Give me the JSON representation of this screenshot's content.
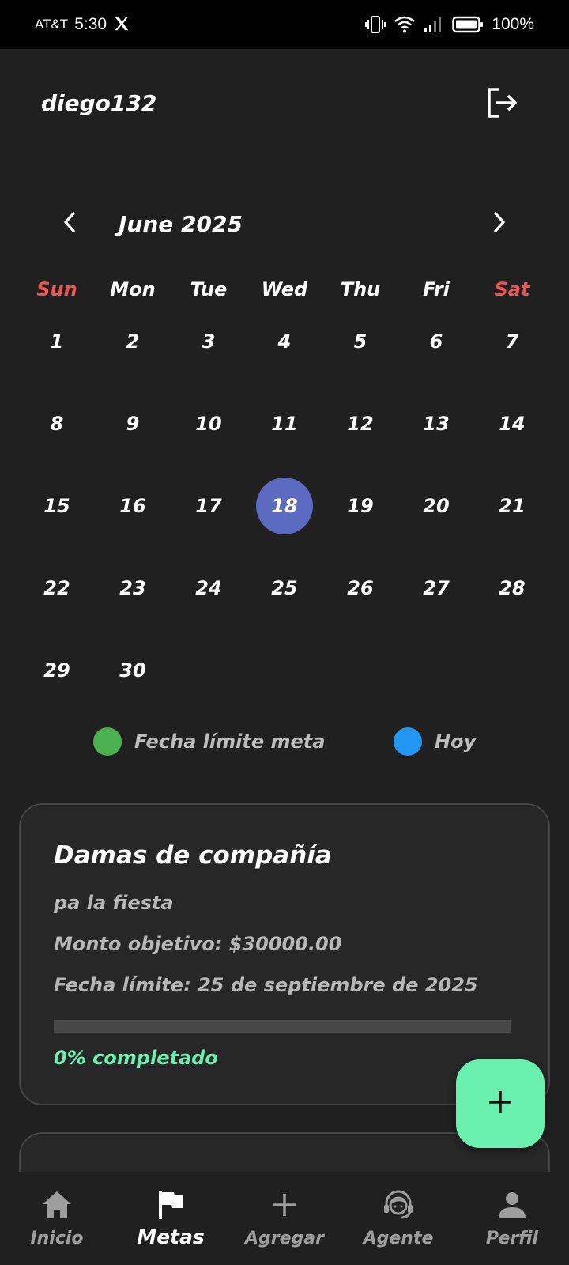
{
  "status_bar": {
    "carrier": "AT&T",
    "time": "5:30",
    "battery": "100%"
  },
  "header": {
    "username": "diego132",
    "logout_icon": "logout-icon"
  },
  "calendar": {
    "month_label": "June 2025",
    "weekdays": [
      "Sun",
      "Mon",
      "Tue",
      "Wed",
      "Thu",
      "Fri",
      "Sat"
    ],
    "days": [
      "1",
      "2",
      "3",
      "4",
      "5",
      "6",
      "7",
      "8",
      "9",
      "10",
      "11",
      "12",
      "13",
      "14",
      "15",
      "16",
      "17",
      "18",
      "19",
      "20",
      "21",
      "22",
      "23",
      "24",
      "25",
      "26",
      "27",
      "28",
      "29",
      "30"
    ],
    "selected_day": "18",
    "selected_color": "#5c6bc0",
    "weekend_color": "#ef5350"
  },
  "legend": {
    "meta_label": "Fecha límite meta",
    "meta_color": "#4caf50",
    "hoy_label": "Hoy",
    "hoy_color": "#2196f3"
  },
  "goal": {
    "title": "Damas de compañía",
    "description": "pa la fiesta",
    "amount_text": "Monto objetivo: $30000.00",
    "deadline_text": "Fecha límite: 25 de septiembre de 2025",
    "progress_fraction": 0,
    "progress_label": "0% completado",
    "accent_color": "#69f0ae"
  },
  "fab": {
    "icon": "plus-icon"
  },
  "bottom_nav": {
    "items": [
      {
        "label": "Inicio",
        "icon": "home-icon"
      },
      {
        "label": "Metas",
        "icon": "flag-icon"
      },
      {
        "label": "Agregar",
        "icon": "plus-icon"
      },
      {
        "label": "Agente",
        "icon": "headset-icon"
      },
      {
        "label": "Perfil",
        "icon": "person-icon"
      }
    ],
    "active": "Metas"
  }
}
